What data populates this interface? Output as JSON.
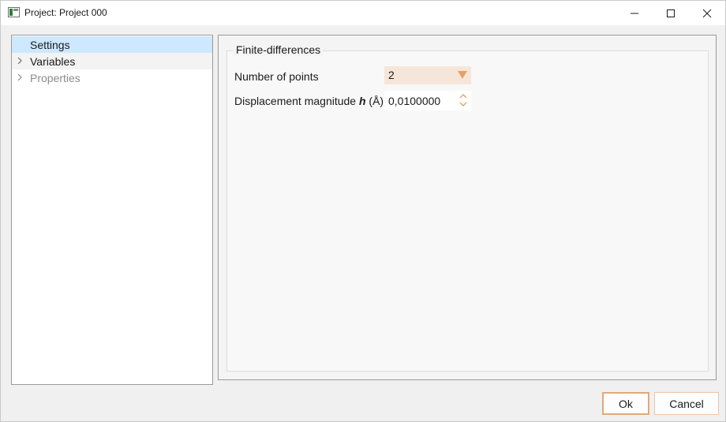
{
  "window": {
    "title": "Project: Project 000"
  },
  "titlebar": {
    "icons": [
      "minimize-icon",
      "maximize-icon",
      "close-icon"
    ]
  },
  "tree": {
    "items": [
      {
        "label": "Settings",
        "state": "selected",
        "expandable": false
      },
      {
        "label": "Variables",
        "state": "normal",
        "expandable": true
      },
      {
        "label": "Properties",
        "state": "disabled",
        "expandable": true
      }
    ]
  },
  "group": {
    "title": "Finite-differences",
    "number_of_points": {
      "label": "Number of points",
      "value": "2"
    },
    "displacement": {
      "label_prefix": "Displacement magnitude ",
      "label_symbol": "h",
      "label_suffix": " (Å)",
      "value": "0,0100000"
    }
  },
  "buttons": {
    "ok": "Ok",
    "cancel": "Cancel"
  },
  "colors": {
    "selection": "#cde8ff",
    "accent": "#e8a068",
    "combo_bg": "#f6e6da"
  }
}
